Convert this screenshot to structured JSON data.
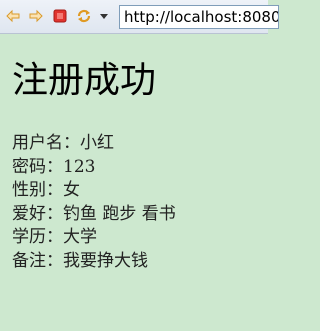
{
  "browser": {
    "address_url": "http://localhost:8080"
  },
  "page": {
    "title": "注册成功",
    "fields": [
      {
        "label": "用户名：",
        "value": "小红"
      },
      {
        "label": "密码：",
        "value": "123"
      },
      {
        "label": "性别：",
        "value": "女"
      },
      {
        "label": "爱好：",
        "value": "钓鱼 跑步 看书"
      },
      {
        "label": "学历：",
        "value": "大学"
      },
      {
        "label": "备注：",
        "value": "我要挣大钱"
      }
    ]
  },
  "colors": {
    "page_background": "#cde8cf",
    "stop_button": "#e0342f",
    "nav_arrow": "#f2b64b"
  },
  "icons": {
    "back": "back-arrow-icon",
    "forward": "forward-arrow-icon",
    "stop": "stop-icon",
    "refresh": "refresh-icon",
    "dropdown": "chevron-down-icon"
  }
}
